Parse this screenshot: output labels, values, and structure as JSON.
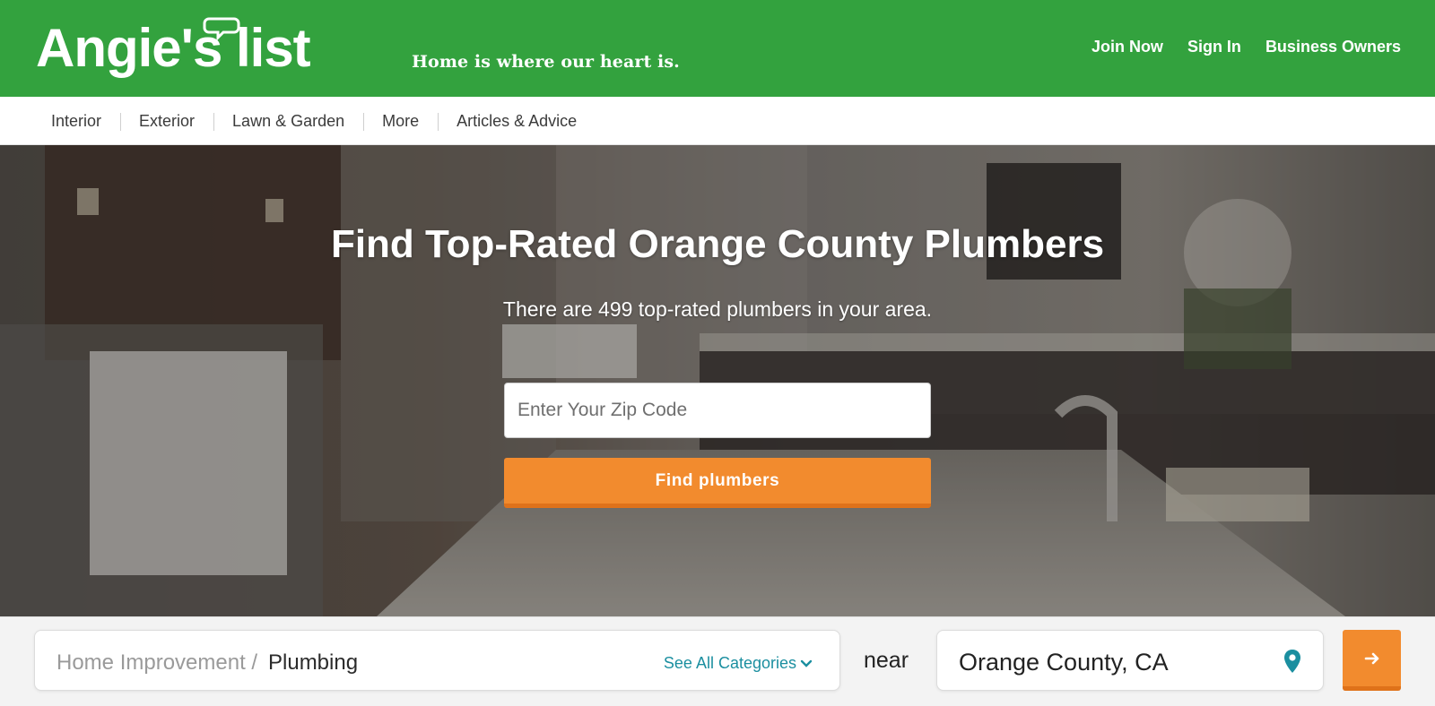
{
  "header": {
    "logo_text": "Angie's list",
    "tagline": "Home is where our heart is.",
    "links": [
      "Join Now",
      "Sign In",
      "Business Owners"
    ],
    "brand_color": "#33a23e"
  },
  "nav": {
    "items": [
      "Interior",
      "Exterior",
      "Lawn & Garden",
      "More",
      "Articles & Advice"
    ]
  },
  "hero": {
    "title": "Find Top-Rated Orange County Plumbers",
    "subtitle": "There are 499 top-rated plumbers in your area.",
    "zip_placeholder": "Enter Your Zip Code",
    "zip_value": "",
    "button_label": "Find plumbers",
    "button_color": "#f28b2e"
  },
  "search": {
    "category_parent": "Home Improvement /",
    "category_current": "Plumbing",
    "see_all_label": "See All Categories",
    "near_label": "near",
    "location": "Orange County, CA",
    "link_color": "#1b8fa0",
    "icons": {
      "dropdown": "chevron-down-icon",
      "location": "map-pin-icon",
      "submit": "arrow-right-icon"
    }
  }
}
